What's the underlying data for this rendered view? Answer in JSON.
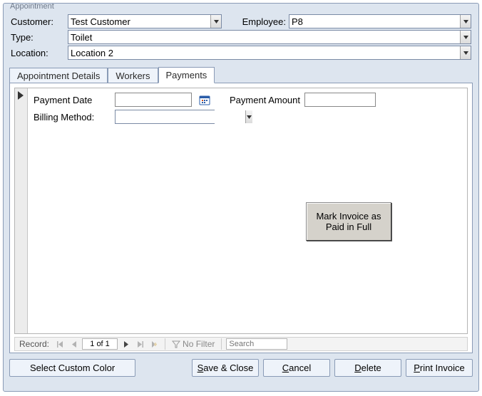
{
  "group_title": "Appointment",
  "header": {
    "customer_label": "Customer:",
    "customer_value": "Test Customer",
    "employee_label": "Employee:",
    "employee_value": "P8",
    "type_label": "Type:",
    "type_value": "Toilet",
    "location_label": "Location:",
    "location_value": "Location 2"
  },
  "tabs": {
    "details": "Appointment Details",
    "workers": "Workers",
    "payments": "Payments"
  },
  "payments": {
    "payment_date_label": "Payment Date",
    "payment_date_value": "",
    "payment_amount_label": "Payment Amount",
    "payment_amount_value": "",
    "billing_method_label": "Billing Method:",
    "billing_method_value": "",
    "mark_paid_btn": "Mark Invoice as Paid in Full"
  },
  "recnav": {
    "label": "Record:",
    "position": "1 of 1",
    "nofilter": "No Filter",
    "search_placeholder": "Search"
  },
  "footer": {
    "select_color": "Select Custom Color",
    "save_close_pre": "S",
    "save_close_rest": "ave & Close",
    "cancel_pre": "C",
    "cancel_rest": "ancel",
    "delete_pre": "D",
    "delete_rest": "elete",
    "print_pre": "P",
    "print_rest": "rint Invoice"
  }
}
